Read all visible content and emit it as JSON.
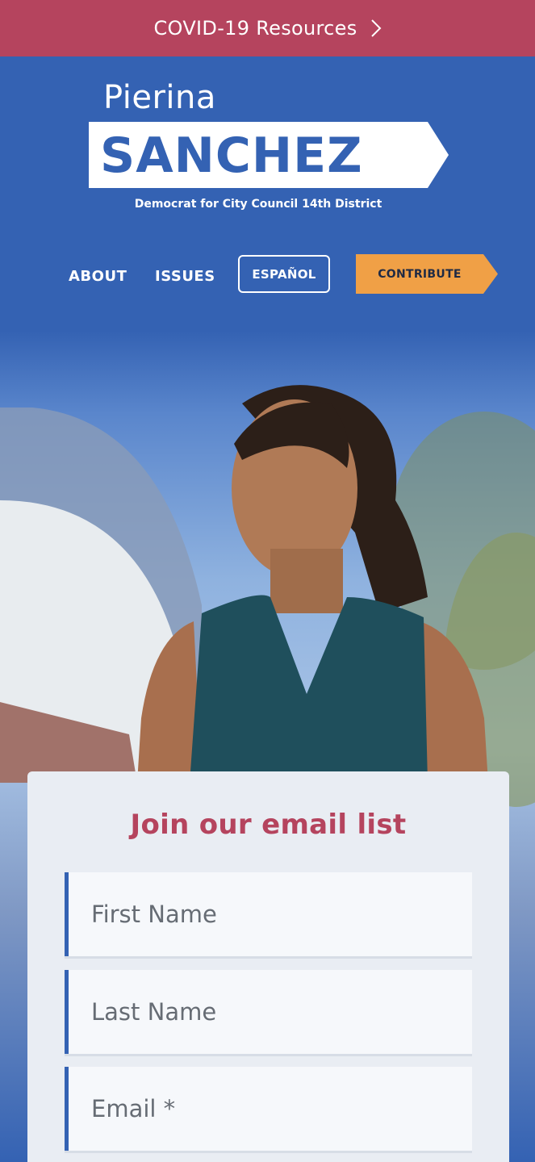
{
  "banner": {
    "text": "COVID-19 Resources",
    "color": "#b5445e"
  },
  "brand": {
    "first_name": "Pierina",
    "last_name": "SANCHEZ",
    "tagline": "Democrat for City Council 14th District",
    "primary_color": "#3462b3"
  },
  "nav": {
    "about": "ABOUT",
    "issues": "ISSUES",
    "espanol": "ESPAÑOL",
    "contribute": "CONTRIBUTE",
    "contribute_color": "#f0a046"
  },
  "signup": {
    "title": "Join our email list",
    "fields": [
      {
        "placeholder": "First Name"
      },
      {
        "placeholder": "Last Name"
      },
      {
        "placeholder": "Email *"
      }
    ]
  }
}
